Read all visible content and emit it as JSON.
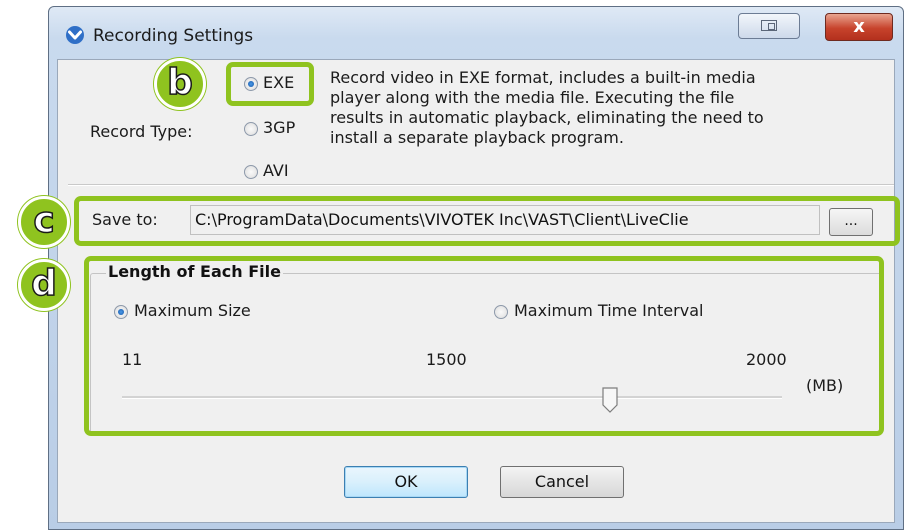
{
  "window": {
    "title": "Recording Settings",
    "close_label": "x"
  },
  "record_type": {
    "label": "Record Type:",
    "options": [
      {
        "label": "EXE",
        "selected": true
      },
      {
        "label": "3GP",
        "selected": false
      },
      {
        "label": "AVI",
        "selected": false
      }
    ],
    "description_lines": [
      "Record video in EXE format, includes a built-in media",
      "player along with the media file. Executing the file",
      "results in automatic playback, eliminating the need to",
      "install a separate playback program."
    ]
  },
  "save_to": {
    "label": "Save to:",
    "path": "C:\\ProgramData\\Documents\\VIVOTEK Inc\\VAST\\Client\\LiveClie",
    "browse_label": "..."
  },
  "file_length": {
    "title": "Length of Each File",
    "options": [
      {
        "label": "Maximum Size",
        "selected": true
      },
      {
        "label": "Maximum Time Interval",
        "selected": false
      }
    ],
    "slider": {
      "min_label": "11",
      "value_label": "1500",
      "max_label": "2000",
      "unit": "(MB)",
      "min": 11,
      "max": 2000,
      "value": 1500
    }
  },
  "buttons": {
    "ok": "OK",
    "cancel": "Cancel"
  },
  "callouts": {
    "b": "b",
    "c": "c",
    "d": "d"
  },
  "colors": {
    "highlight": "#8fc31f",
    "title_close": "#c7432c",
    "dialog_bg": "#f0f0f0"
  },
  "icons": {
    "app": "vivotek-chevron-icon",
    "restore": "restore-window-icon",
    "close": "close-icon"
  }
}
